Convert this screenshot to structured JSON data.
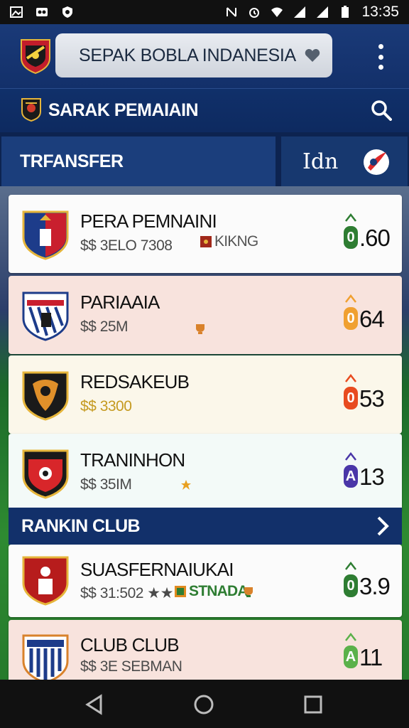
{
  "status_bar": {
    "time": "13:35",
    "icons": [
      "photo-icon",
      "headset-icon",
      "shield-icon",
      "nfc-icon",
      "alarm-icon",
      "wifi-icon",
      "signal-icon",
      "battery-icon"
    ]
  },
  "header": {
    "app_title": "SEPAK BOBLA INDANESIA",
    "icons": [
      "club-logo-icon",
      "heart-icon",
      "more-vert-icon"
    ]
  },
  "section": {
    "title": "SARAK PEMAIAIN"
  },
  "tabs": {
    "transfer_label": "TRFANSFER",
    "secondary_label": "Idn"
  },
  "cards": [
    {
      "name": "PERA PEMNAINI",
      "meta": "$$ 3ELO 7308",
      "extra": "KIKNG",
      "rank_value": ".60",
      "rank_badge": "0",
      "badge_color": "#2e7d32"
    },
    {
      "name": "PARIAAIA",
      "meta": "$$ 25M",
      "extra": "",
      "rank_value": "64",
      "rank_badge": "0",
      "badge_color": "#f0a030"
    },
    {
      "name": "REDSAKEUB",
      "meta": "$$ 3300",
      "extra": "",
      "rank_value": "53",
      "rank_badge": "0",
      "badge_color": "#e84b1f"
    },
    {
      "name": "TRANINHON",
      "meta": "$$ 35IM",
      "extra": "",
      "rank_value": "13",
      "rank_badge": "A",
      "badge_color": "#4a36a8"
    }
  ],
  "ranking": {
    "title": "RANKIN CLUB"
  },
  "ranking_cards": [
    {
      "name": "SUASFERNAIUKAI",
      "meta": "$$ 31:502 ★★",
      "extra": "STNADA",
      "rank_value": "3.9",
      "rank_badge": "0",
      "badge_color": "#2e7d32"
    },
    {
      "name": "CLUB CLUB",
      "meta": "$$ 3E SEBMAN",
      "extra": "",
      "rank_value": "11",
      "rank_badge": "A",
      "badge_color": "#5bb14a"
    }
  ],
  "nav": {
    "icons": [
      "back-icon",
      "home-icon",
      "recents-icon"
    ]
  }
}
